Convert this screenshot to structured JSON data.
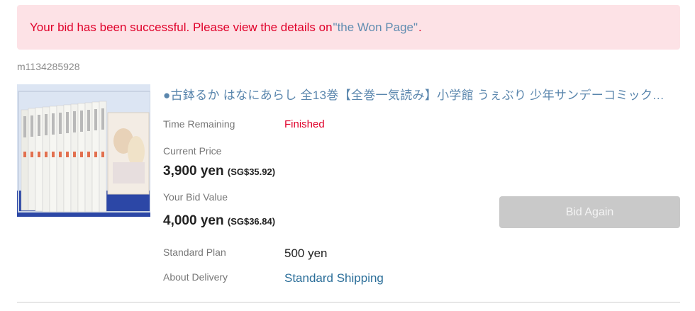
{
  "alert": {
    "message": "Your bid has been successful. Please view the details on ",
    "link_text": "\"the Won Page\"",
    "period": "."
  },
  "item": {
    "id": "m1134285928",
    "title": "●古鉢るか はなにあらし 全13巻【全巻一気読み】小学館 うぇぶり 少年サンデーコミックス 全巻セット",
    "time_remaining_label": "Time Remaining",
    "time_remaining_value": "Finished",
    "current_price_label": "Current Price",
    "current_price": "3,900 yen",
    "current_price_converted": "(SG$35.92)",
    "bid_value_label": "Your Bid Value",
    "bid_value": "4,000 yen",
    "bid_value_converted": "(SG$36.84)",
    "plan_label": "Standard Plan",
    "plan_value": "500 yen",
    "delivery_label": "About Delivery",
    "delivery_value": "Standard Shipping"
  },
  "actions": {
    "bid_again": "Bid Again"
  },
  "colors": {
    "alert_bg": "#fde2e6",
    "alert_text": "#e0002a",
    "link": "#2b6e99",
    "title": "#5a86ad",
    "disabled_button": "#c9c9c9"
  }
}
